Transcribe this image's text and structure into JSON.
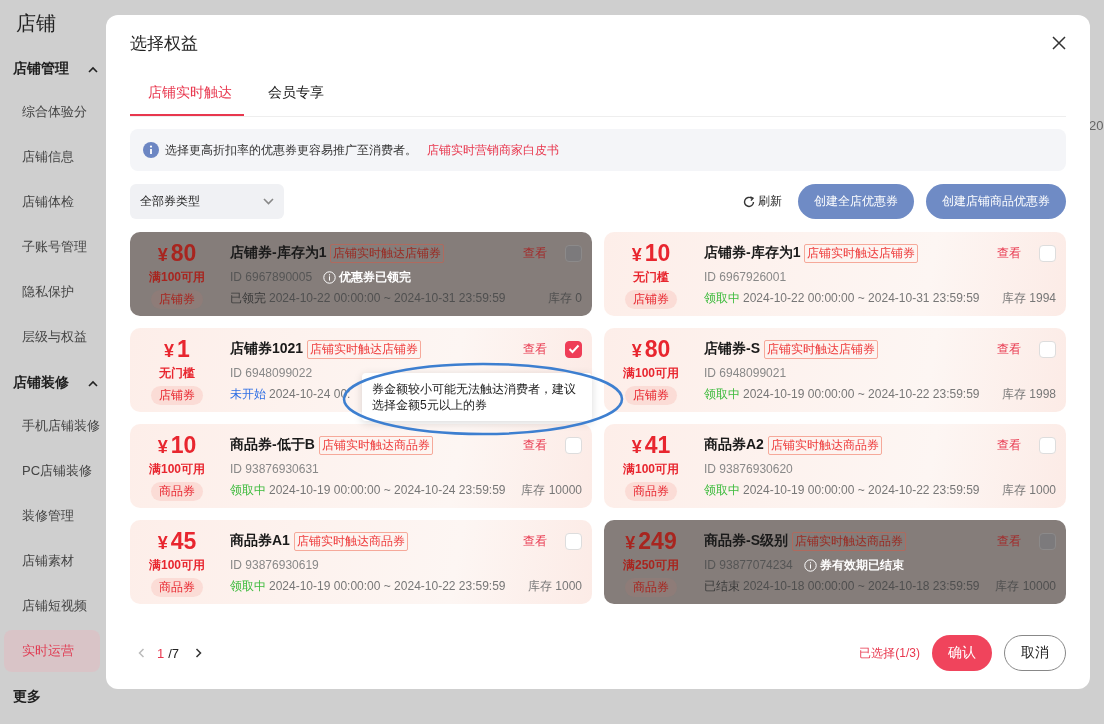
{
  "sidebar": {
    "title": "店铺",
    "sections": [
      {
        "label": "店铺管理",
        "expanded": true,
        "items": [
          {
            "label": "综合体验分",
            "selected": false
          },
          {
            "label": "店铺信息",
            "selected": false
          },
          {
            "label": "店铺体检",
            "selected": false
          },
          {
            "label": "子账号管理",
            "selected": false
          },
          {
            "label": "隐私保护",
            "selected": false
          },
          {
            "label": "层级与权益",
            "selected": false
          }
        ]
      },
      {
        "label": "店铺装修",
        "expanded": true,
        "items": [
          {
            "label": "手机店铺装修",
            "selected": false
          },
          {
            "label": "PC店铺装修",
            "selected": false
          },
          {
            "label": "装修管理",
            "selected": false
          },
          {
            "label": "店铺素材",
            "selected": false
          },
          {
            "label": "店铺短视频",
            "selected": false
          },
          {
            "label": "实时运营",
            "selected": true
          }
        ]
      }
    ],
    "more": "更多"
  },
  "background_text": "20",
  "dialog": {
    "title": "选择权益",
    "tabs": [
      {
        "label": "店铺实时触达",
        "selected": true
      },
      {
        "label": "会员专享",
        "selected": false
      }
    ],
    "notice": {
      "text": "选择更高折扣率的优惠券更容易推广至消费者。",
      "link": "店铺实时营销商家白皮书"
    },
    "filter": {
      "value": "全部券类型"
    },
    "refresh": "刷新",
    "buttons": [
      "创建全店优惠券",
      "创建店铺商品优惠券"
    ],
    "coupons": [
      {
        "currency": "¥",
        "amount": "80",
        "condition": "满100可用",
        "type": "店铺券",
        "name": "店铺券-库存为1",
        "tag": "店铺实时触达店铺券",
        "id": "ID 6967890005",
        "notice": "优惠券已领完",
        "status": "已领完",
        "color": "#3a3a3a",
        "dates": "2024-10-22 00:00:00 ~ 2024-10-31 23:59:59",
        "stock": "库存 0",
        "view": "查看",
        "checked": false,
        "disabled": true
      },
      {
        "currency": "¥",
        "amount": "10",
        "condition": "无门槛",
        "type": "店铺券",
        "name": "店铺券-库存为1",
        "tag": "店铺实时触达店铺券",
        "id": "ID 6967926001",
        "status": "领取中",
        "color": "#3dbb3d",
        "dates": "2024-10-22 00:00:00 ~ 2024-10-31 23:59:59",
        "stock": "库存 1994",
        "view": "查看",
        "checked": false,
        "disabled": false
      },
      {
        "currency": "¥",
        "amount": "1",
        "condition": "无门槛",
        "type": "店铺券",
        "name": "店铺券1021",
        "tag": "店铺实时触达店铺券",
        "id": "ID 6948099022",
        "status": "未开始",
        "color": "#2f6fe4",
        "dates": "2024-10-24 00:",
        "view": "查看",
        "checked": true,
        "disabled": false
      },
      {
        "currency": "¥",
        "amount": "80",
        "condition": "满100可用",
        "type": "店铺券",
        "name": "店铺券-S",
        "tag": "店铺实时触达店铺券",
        "id": "ID 6948099021",
        "status": "领取中",
        "color": "#3dbb3d",
        "dates": "2024-10-19 00:00:00 ~ 2024-10-22 23:59:59",
        "stock": "库存 1998",
        "view": "查看",
        "checked": false,
        "disabled": false
      },
      {
        "currency": "¥",
        "amount": "10",
        "condition": "满100可用",
        "type": "商品券",
        "name": "商品券-低于B",
        "tag": "店铺实时触达商品券",
        "id": "ID 93876930631",
        "status": "领取中",
        "color": "#3dbb3d",
        "dates": "2024-10-19 00:00:00 ~ 2024-10-24 23:59:59",
        "stock": "库存 10000",
        "view": "查看",
        "checked": false,
        "disabled": false
      },
      {
        "currency": "¥",
        "amount": "41",
        "condition": "满100可用",
        "type": "商品券",
        "name": "商品券A2",
        "tag": "店铺实时触达商品券",
        "id": "ID 93876930620",
        "status": "领取中",
        "color": "#3dbb3d",
        "dates": "2024-10-19 00:00:00 ~ 2024-10-22 23:59:59",
        "stock": "库存 1000",
        "view": "查看",
        "checked": false,
        "disabled": false
      },
      {
        "currency": "¥",
        "amount": "45",
        "condition": "满100可用",
        "type": "商品券",
        "name": "商品券A1",
        "tag": "店铺实时触达商品券",
        "id": "ID 93876930619",
        "status": "领取中",
        "color": "#3dbb3d",
        "dates": "2024-10-19 00:00:00 ~ 2024-10-22 23:59:59",
        "stock": "库存 1000",
        "view": "查看",
        "checked": false,
        "disabled": false
      },
      {
        "currency": "¥",
        "amount": "249",
        "condition": "满250可用",
        "type": "商品券",
        "name": "商品券-S级别",
        "tag": "店铺实时触达商品券",
        "id": "ID 93877074234",
        "notice": "券有效期已结束",
        "status": "已结束",
        "color": "#3a3a3a",
        "dates": "2024-10-18 00:00:00 ~ 2024-10-18 23:59:59",
        "stock": "库存 10000",
        "view": "查看",
        "checked": false,
        "disabled": true
      }
    ],
    "tooltip": "券金额较小可能无法触达消费者，建议选择金额5元以上的券",
    "pagination": {
      "current": "1",
      "total": "/7"
    },
    "selected_count": "已选择(1/3)",
    "confirm": "确认",
    "cancel": "取消"
  }
}
